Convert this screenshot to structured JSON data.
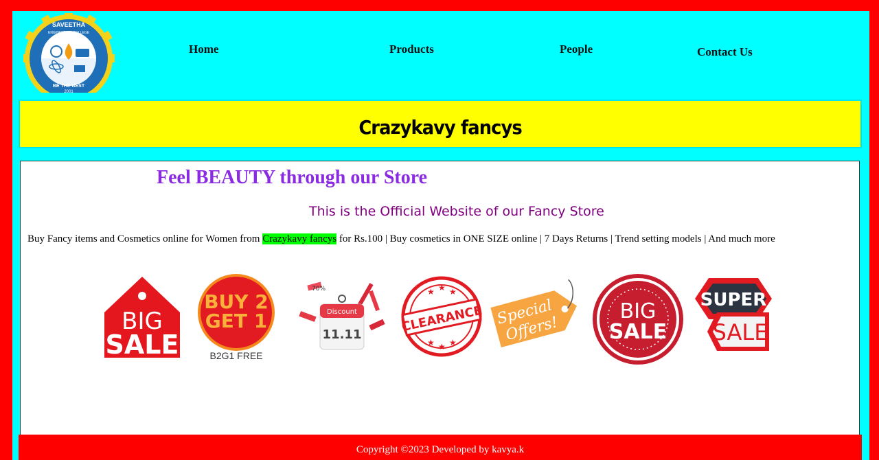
{
  "nav": {
    "items": [
      {
        "label": "Home"
      },
      {
        "label": "Products"
      },
      {
        "label": "People"
      },
      {
        "label": "Contact Us"
      }
    ]
  },
  "logo": {
    "name": "SAVEETHA",
    "sub": "ENGINEERING COLLEGE",
    "motto": "BE THE BEST",
    "year": "2001"
  },
  "banner": {
    "title": "Crazykavy fancys"
  },
  "main": {
    "tagline": "Feel BEAUTY through our Store",
    "official": "This is the Official Website of our Fancy Store",
    "desc_before": "Buy Fancy items and Cosmetics online for Women from ",
    "desc_highlight": "Crazykavy fancys",
    "desc_after": " for Rs.100 | Buy cosmetics in ONE SIZE online | 7 Days Returns | Trend setting models | And much more"
  },
  "offers": {
    "big_sale_1": {
      "top": "BIG",
      "bottom": "SALE"
    },
    "buy2get1": {
      "line1": "BUY 2",
      "line2": "GET 1",
      "caption": "B2G1 FREE"
    },
    "discount": {
      "pct": "70%",
      "label": "Discount",
      "date": "11.11"
    },
    "clearance": {
      "label": "CLEARANCE"
    },
    "special": {
      "line1": "Special",
      "line2": "Offers!"
    },
    "big_sale_2": {
      "top": "BIG",
      "bottom": "SALE"
    },
    "super_sale": {
      "top": "SUPER",
      "bottom": "SALE"
    }
  },
  "footer": {
    "text": "Copyright ©2023 Developed by kavya.k"
  },
  "colors": {
    "page_border": "#ff0000",
    "header_bg": "#00ffff",
    "banner_bg": "#ffff00",
    "tagline": "#8a2be2",
    "official": "#800080",
    "highlight": "#00ff00",
    "footer_bg": "#ff0000"
  }
}
